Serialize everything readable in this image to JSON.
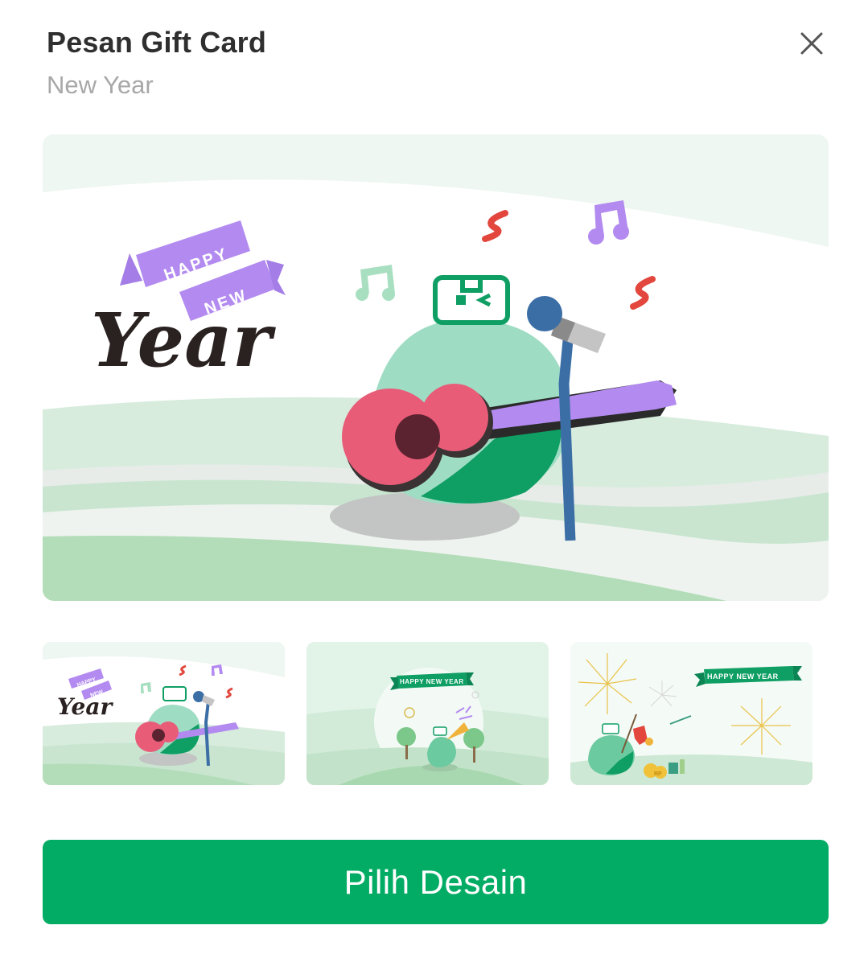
{
  "header": {
    "title": "Pesan Gift Card",
    "subtitle": "New Year"
  },
  "hero": {
    "banner_line1": "HAPPY",
    "banner_line2": "NEW",
    "script_word": "Year"
  },
  "thumbnails": [
    {
      "banner_line1": "HAPPY",
      "banner_line2": "NEW",
      "script_word": "Year",
      "selected": true
    },
    {
      "banner_text": "HAPPY NEW YEAR"
    },
    {
      "banner_text": "HAPPY NEW YEAR",
      "coin_text": "RP"
    }
  ],
  "cta": {
    "label": "Pilih Desain"
  },
  "colors": {
    "primary": "#03ac64",
    "mascot_green": "#0f9e63",
    "mascot_light": "#9fdcc4",
    "guitar": "#e85c78",
    "purple": "#b38bf0",
    "note_red": "#e2463d",
    "mic_blue": "#3b6ea5"
  },
  "icons": [
    "close-icon"
  ]
}
